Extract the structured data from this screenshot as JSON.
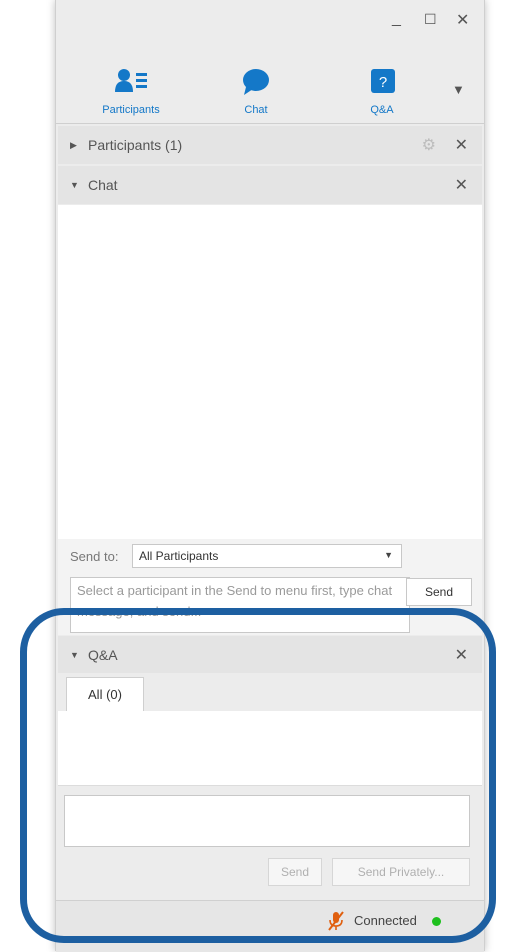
{
  "window_controls": {
    "minimize": "_",
    "maximize": "☐",
    "close": "✕"
  },
  "tabs": [
    {
      "label": "Participants",
      "icon": "participants-icon"
    },
    {
      "label": "Chat",
      "icon": "chat-bubble-icon"
    },
    {
      "label": "Q&A",
      "icon": "question-icon"
    }
  ],
  "tab_menu_icon": "▼",
  "participants_section": {
    "title": "Participants (1)"
  },
  "chat_section": {
    "title": "Chat",
    "send_to_label": "Send to:",
    "send_to_value": "All Participants",
    "input_placeholder": "Select a participant in the Send to menu first, type chat message, and send...",
    "send_button": "Send"
  },
  "qa_section": {
    "title": "Q&A",
    "tab_all": "All (0)",
    "send_button": "Send",
    "send_privately_button": "Send Privately..."
  },
  "status": {
    "text": "Connected"
  },
  "colors": {
    "accent": "#1478c8",
    "highlight_border": "#1d5fa1",
    "connected": "#1ec01e",
    "mic_muted": "#e06010"
  }
}
